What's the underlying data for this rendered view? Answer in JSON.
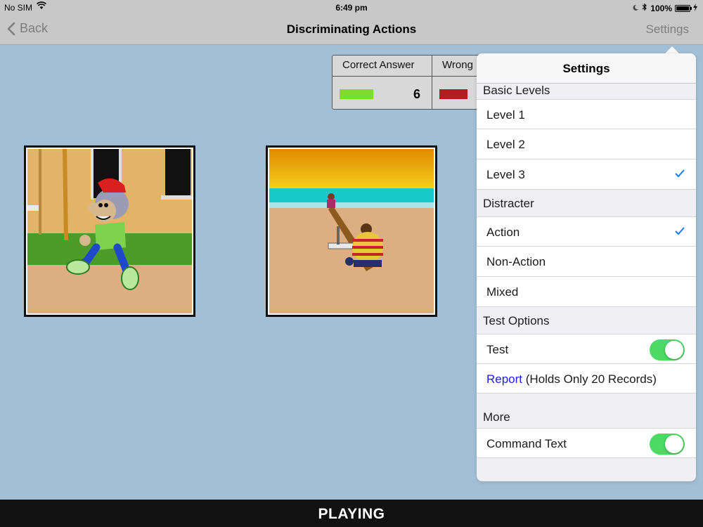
{
  "status_bar": {
    "carrier": "No SIM",
    "time": "6:49 pm",
    "battery": "100%",
    "battery_level": 1.0
  },
  "nav": {
    "back_label": "Back",
    "title": "Discriminating Actions",
    "settings_label": "Settings"
  },
  "score": {
    "correct_label": "Correct Answer",
    "correct_value": "6",
    "correct_color": "#7ddc2e",
    "wrong_label": "Wrong",
    "wrong_color": "#b51d22"
  },
  "settings": {
    "title": "Settings",
    "basic_levels": {
      "title": "Basic Levels",
      "items": [
        {
          "label": "Level 1",
          "checked": false
        },
        {
          "label": "Level 2",
          "checked": false
        },
        {
          "label": "Level 3",
          "checked": true
        }
      ]
    },
    "distracter": {
      "title": "Distracter",
      "items": [
        {
          "label": "Action",
          "checked": true
        },
        {
          "label": "Non-Action",
          "checked": false
        },
        {
          "label": "Mixed",
          "checked": false
        }
      ]
    },
    "test_options": {
      "title": "Test Options",
      "test_label": "Test",
      "test_on": true,
      "report_link": "Report",
      "report_note": "(Holds Only 20 Records)"
    },
    "more": {
      "title": "More",
      "command_text_label": "Command Text",
      "command_text_on": true
    },
    "accent_color": "#1a7bea",
    "toggle_color": "#4cd964"
  },
  "footer": {
    "status": "PLAYING"
  }
}
